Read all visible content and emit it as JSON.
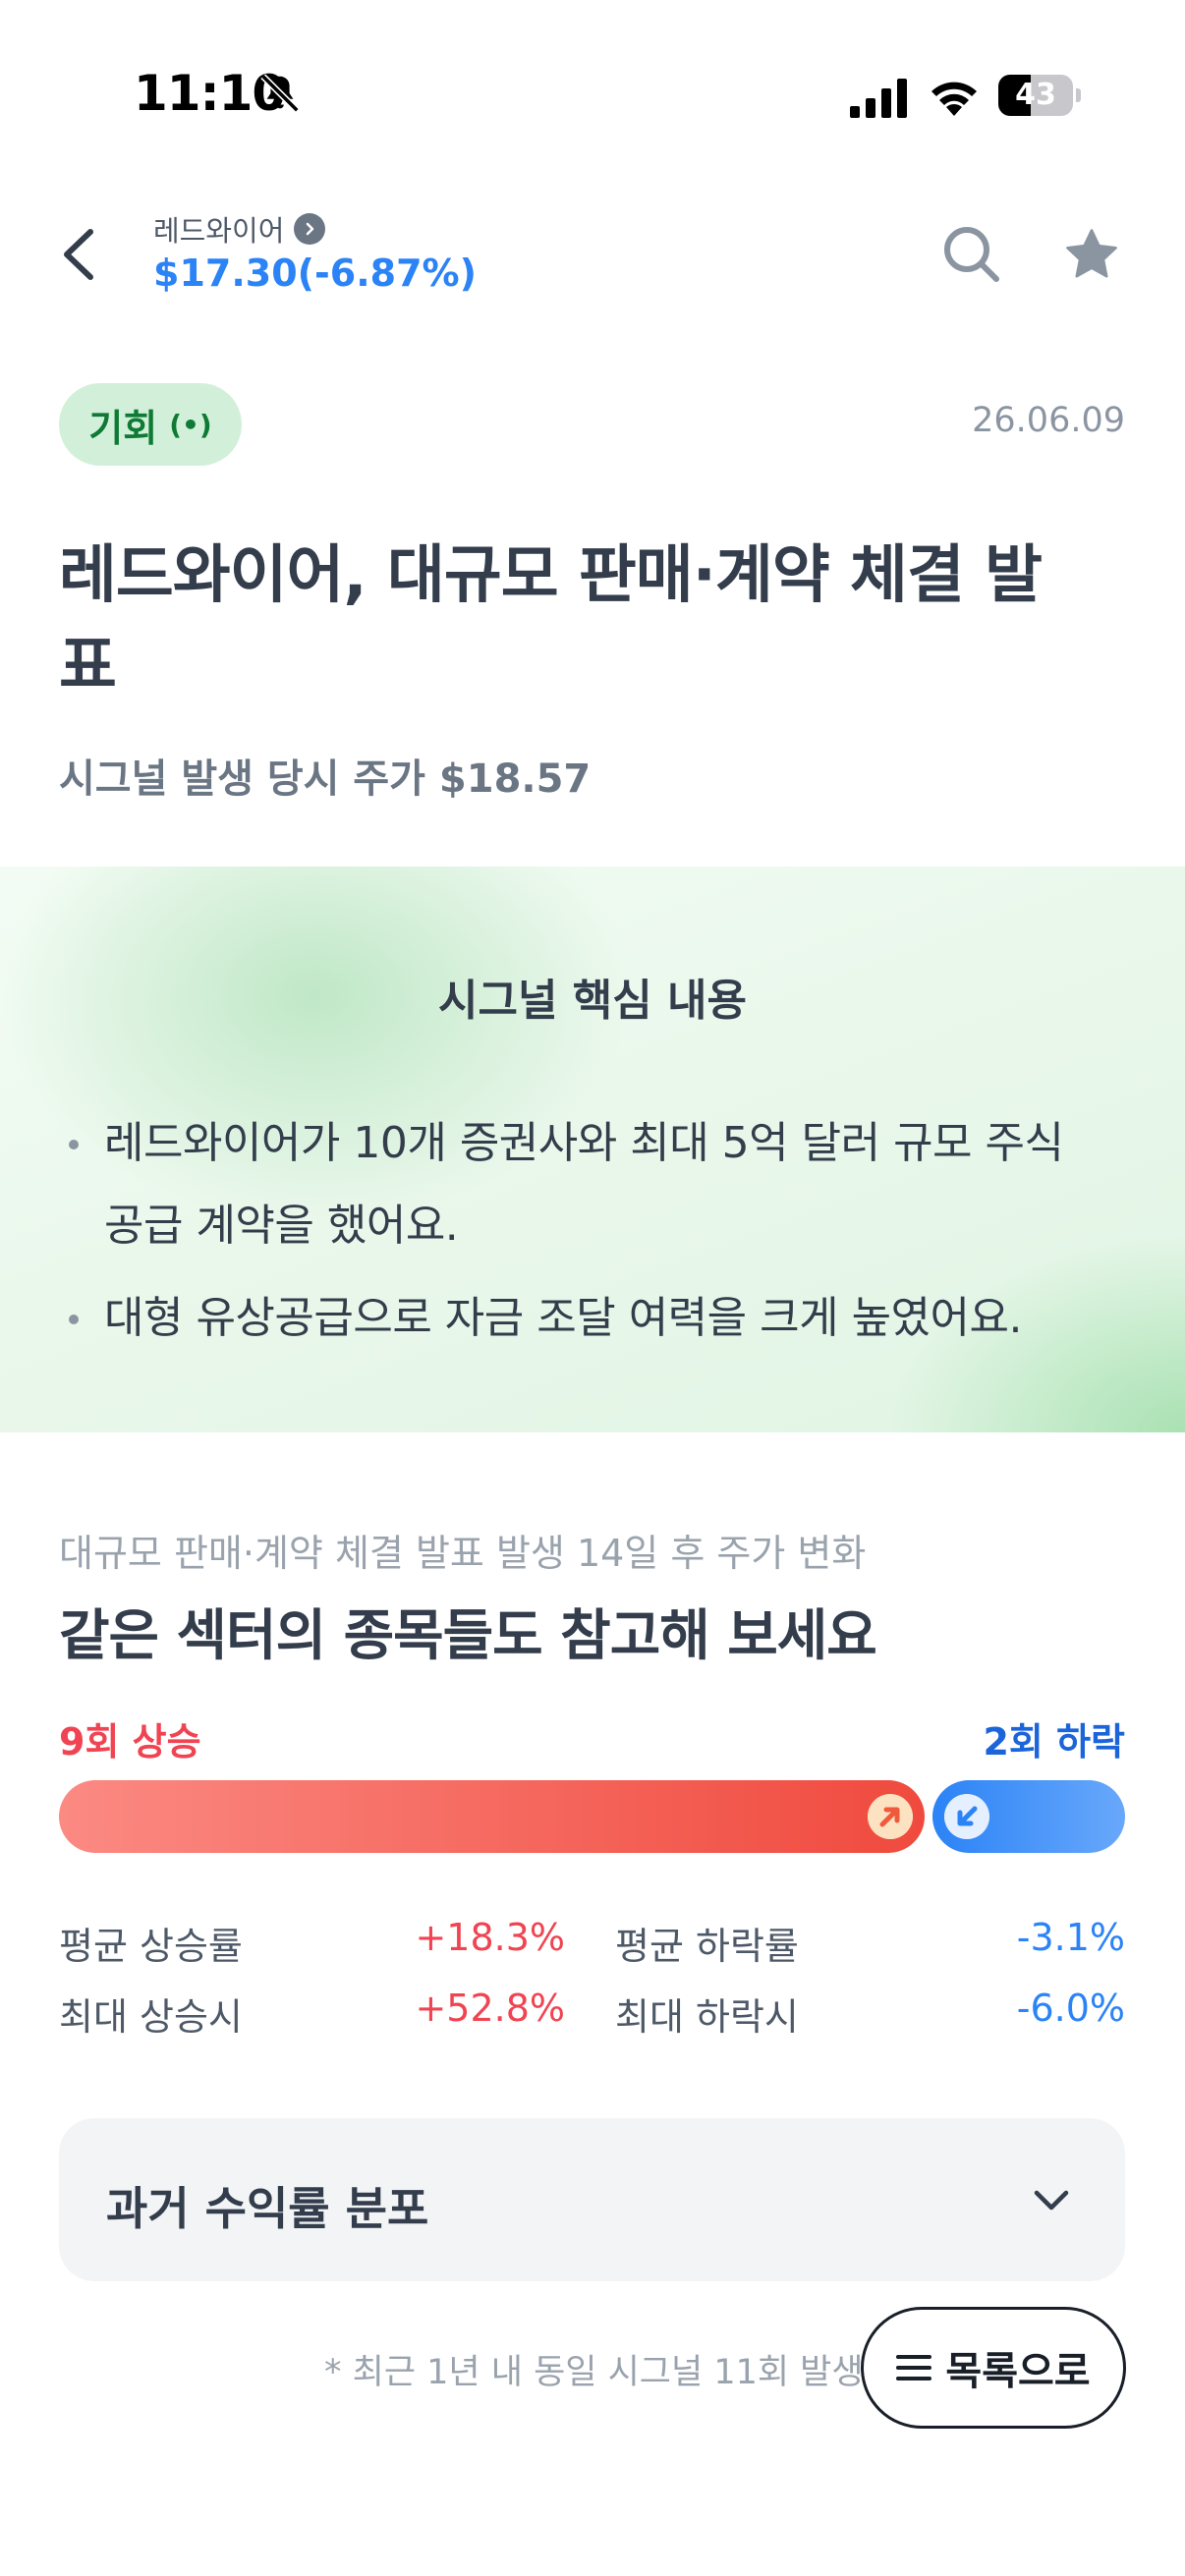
{
  "status_bar": {
    "time": "11:10",
    "battery": "43",
    "battery_level": 0.43,
    "icons": [
      "bell-off-icon",
      "cellular-signal-icon",
      "wifi-icon",
      "battery-icon"
    ]
  },
  "header": {
    "stock_name": "레드와이어",
    "stock_price": "$17.30(-6.87%)",
    "icons": [
      "back-arrow-icon",
      "chevron-right-icon",
      "search-icon",
      "star-icon"
    ]
  },
  "signal": {
    "tag": "기회",
    "tag_icon": "(•)",
    "date": "26.06.09",
    "title": "레드와이어, 대규모 판매·계약 체결 발표",
    "price_at_signal": "시그널 발생 당시 주가 $18.57"
  },
  "key_content": {
    "title": "시그널 핵심 내용",
    "bullets": [
      "레드와이어가 10개 증권사와 최대 5억 달러 규모 주식 공급 계약을 했어요.",
      "대형 유상공급으로 자금 조달 여력을 크게 높였어요."
    ]
  },
  "stats": {
    "subtitle": "대규모 판매·계약 체결 발표 발생 14일 후 주가 변화",
    "title": "같은 섹터의 종목들도 참고해 보세요",
    "up_label": "9회 상승",
    "down_label": "2회 하락",
    "up_count": 9,
    "down_count": 2,
    "avg_up_label": "평균 상승률",
    "avg_up_value": "+18.3%",
    "avg_down_label": "평균 하락률",
    "avg_down_value": "-3.1%",
    "max_up_label": "최대 상승시",
    "max_up_value": "+52.8%",
    "max_down_label": "최대 하락시",
    "max_down_value": "-6.0%",
    "colors": {
      "up": "#f04452",
      "down": "#2b83f6"
    }
  },
  "accordion": {
    "label": "과거 수익률 분포"
  },
  "footer": {
    "note": "* 최근 1년 내 동일 시그널 11회 발생",
    "list_button": "목록으로"
  }
}
